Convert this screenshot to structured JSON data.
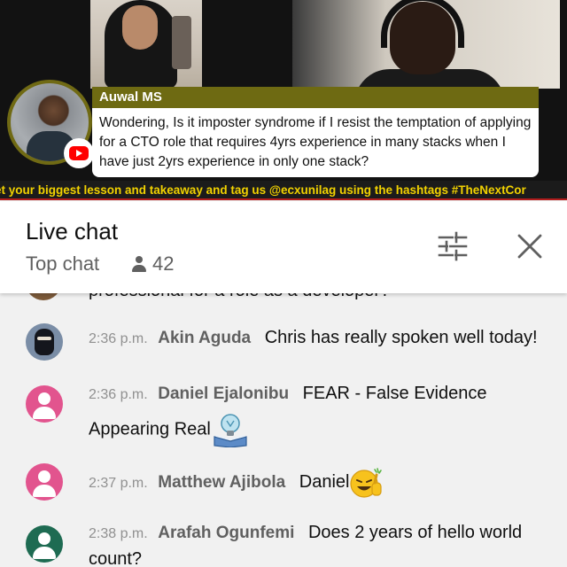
{
  "stream": {
    "overlay_name": "Auwal MS",
    "overlay_question": "Wondering, Is it imposter syndrome if I resist the temptation of applying for a CTO role that requires 4yrs experience in many stacks when I have just 2yrs experience in only one stack?",
    "ticker_text": "et your biggest lesson and takeaway and tag us @ecxunilag using the hashtags #TheNextCor"
  },
  "chat_header": {
    "title": "Live chat",
    "mode": "Top chat",
    "viewer_count": "42",
    "icons": [
      "filter-icon",
      "close-icon"
    ]
  },
  "chat": {
    "cut_text": "professional for a role as a developer?",
    "messages": [
      {
        "time": "2:36 p.m.",
        "author": "Akin Aguda",
        "text": "Chris has really spoken well today!",
        "avatar": "ninja-avatar"
      },
      {
        "time": "2:36 p.m.",
        "author": "Daniel Ejalonibu",
        "text": "FEAR - False Evidence Appearing Real",
        "emoji": "lightbulb-book-emoji",
        "avatar": "default-pink-avatar"
      },
      {
        "time": "2:37 p.m.",
        "author": "Matthew Ajibola",
        "text": "Daniel",
        "emoji": "grinning-thumbs-up-emoji",
        "avatar": "default-pink-avatar"
      },
      {
        "time": "2:38 p.m.",
        "author": "Arafah Ogunfemi",
        "text": "Does 2 years of hello world count?",
        "avatar": "default-green-avatar"
      }
    ]
  },
  "colors": {
    "banner": "#6e6a12",
    "ticker_text": "#f2d200",
    "accent_line": "#b31e1e",
    "author_text": "#606060",
    "time_text": "#909090"
  }
}
